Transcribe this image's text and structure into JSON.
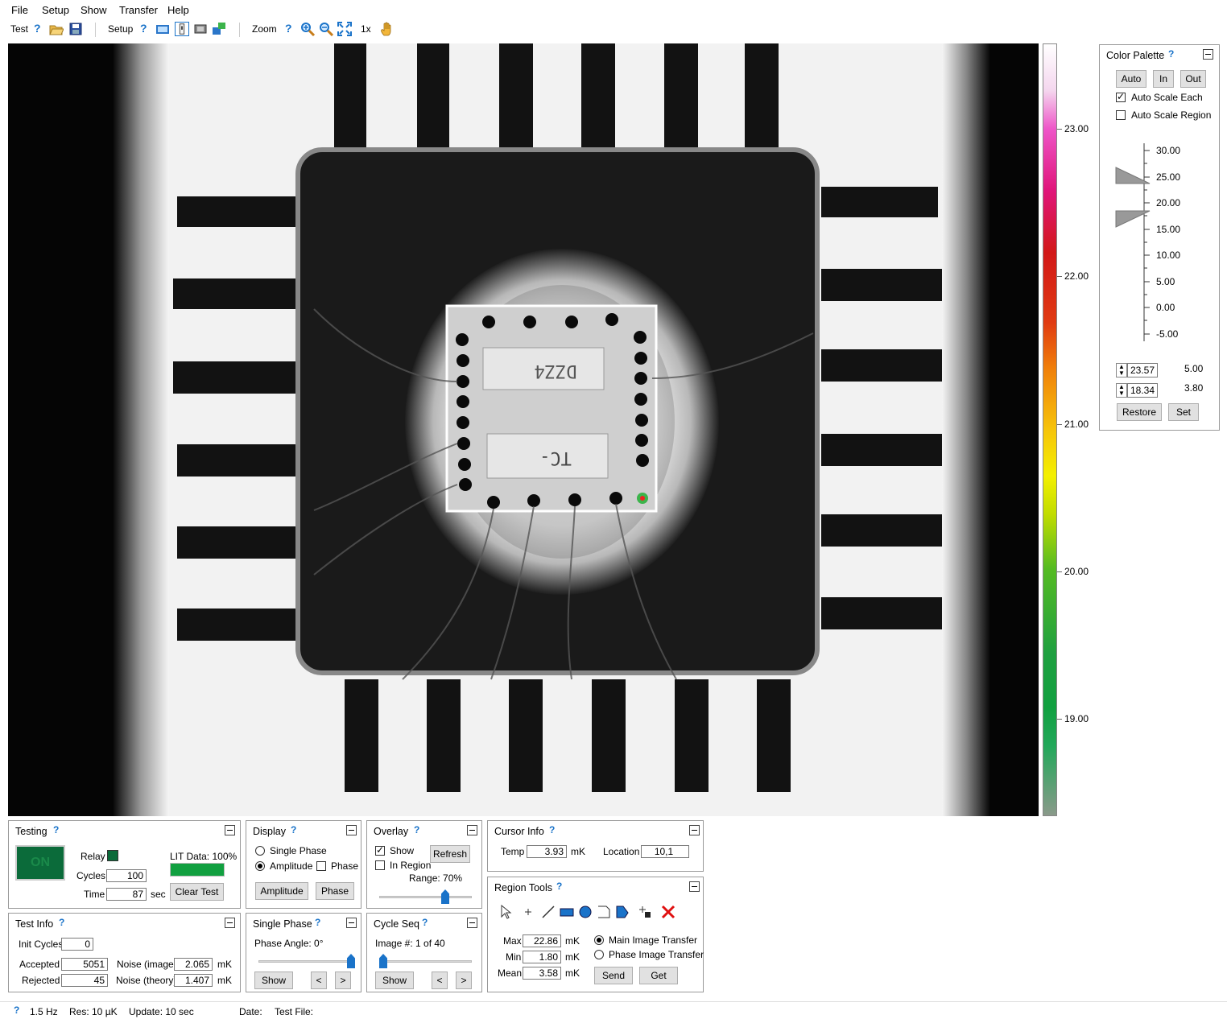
{
  "menu": [
    "File",
    "Setup",
    "Show",
    "Transfer",
    "Help"
  ],
  "toolbar": {
    "test_label": "Test",
    "setup_label": "Setup",
    "zoom_label": "Zoom",
    "zoom_level": "1x",
    "help": "?"
  },
  "colorbar": {
    "ticks": [
      "23.00",
      "22.00",
      "21.00",
      "20.00",
      "19.00"
    ]
  },
  "color_palette": {
    "title": "Color Palette",
    "auto": "Auto",
    "in": "In",
    "out": "Out",
    "auto_scale_each": "Auto Scale Each",
    "auto_scale_region": "Auto Scale Region",
    "scale": [
      "30.00",
      "25.00",
      "20.00",
      "15.00",
      "10.00",
      "5.00",
      "0.00",
      "-5.00"
    ],
    "upper_value": "23.57",
    "lower_value": "18.34",
    "upper_side": "5.00",
    "lower_side": "3.80",
    "restore": "Restore",
    "set": "Set"
  },
  "testing": {
    "title": "Testing",
    "on": "ON",
    "relay": "Relay",
    "cycles_label": "Cycles",
    "cycles": "100",
    "time_label": "Time",
    "time": "87",
    "sec": "sec",
    "lit_data": "LIT Data: 100%",
    "clear_test": "Clear Test",
    "lit_progress": 1.0
  },
  "display": {
    "title": "Display",
    "single_phase": "Single Phase",
    "amplitude": "Amplitude",
    "phase": "Phase",
    "amplitude_btn": "Amplitude",
    "phase_btn": "Phase"
  },
  "overlay": {
    "title": "Overlay",
    "show": "Show",
    "refresh": "Refresh",
    "in_region": "In Region",
    "range": "Range: 70%",
    "range_value": 0.7
  },
  "cursor_info": {
    "title": "Cursor Info",
    "temp_label": "Temp",
    "temp": "3.93",
    "unit": "mK",
    "location_label": "Location",
    "location": "10,1"
  },
  "test_info": {
    "title": "Test Info",
    "init_cycles_label": "Init Cycles",
    "init_cycles": "0",
    "accepted_label": "Accepted",
    "accepted": "5051",
    "rejected_label": "Rejected",
    "rejected": "45",
    "noise_image_label": "Noise (image)",
    "noise_image": "2.065",
    "noise_theory_label": "Noise (theory)",
    "noise_theory": "1.407",
    "unit": "mK"
  },
  "single_phase": {
    "title": "Single Phase",
    "phase_angle": "Phase Angle: 0°",
    "show": "Show",
    "prev": "<",
    "next": ">",
    "slider_value": 1.0
  },
  "cycle_seq": {
    "title": "Cycle Seq",
    "image_num": "Image #: 1 of 40",
    "show": "Show",
    "prev": "<",
    "next": ">",
    "slider_value": 0.0
  },
  "region_tools": {
    "title": "Region Tools",
    "max_label": "Max",
    "max": "22.86",
    "min_label": "Min",
    "min": "1.80",
    "mean_label": "Mean",
    "mean": "3.58",
    "unit": "mK",
    "main_transfer": "Main Image Transfer",
    "phase_transfer": "Phase Image Transfer",
    "send": "Send",
    "get": "Get"
  },
  "status": {
    "help": "?",
    "freq": "1.5 Hz",
    "res": "Res:  10 µK",
    "update": "Update:  10 sec",
    "date": "Date:",
    "test_file": "Test File:"
  }
}
